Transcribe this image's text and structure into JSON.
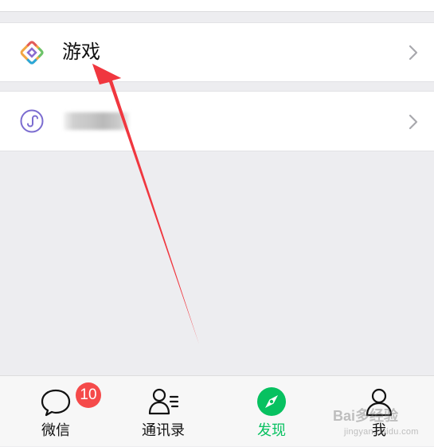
{
  "rows": {
    "games": {
      "label": "游戏",
      "icon": "games-diamond-icon"
    },
    "mini_programs": {
      "label": "",
      "icon": "mini-program-icon",
      "label_obscured": true
    }
  },
  "tabbar": {
    "tabs": [
      {
        "label": "微信",
        "icon": "chat-bubble-icon",
        "badge": "10",
        "active": false
      },
      {
        "label": "通讯录",
        "icon": "contacts-icon",
        "active": false
      },
      {
        "label": "发现",
        "icon": "compass-icon",
        "active": true
      },
      {
        "label": "我",
        "icon": "person-icon",
        "active": false
      }
    ]
  },
  "colors": {
    "accent_green": "#07c160",
    "badge_red": "#f54a4a",
    "annotation_arrow": "#f0373f",
    "background": "#ededf0"
  },
  "watermark": {
    "logo": "Bai多经验",
    "sub": "jingyan.baidu.com"
  }
}
